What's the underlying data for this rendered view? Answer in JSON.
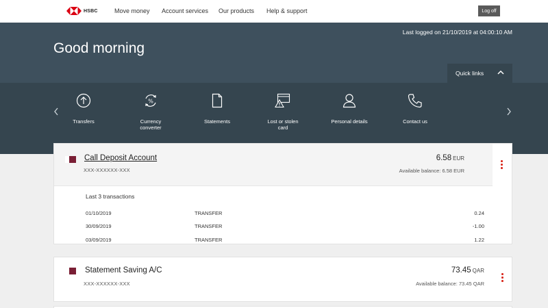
{
  "header": {
    "logo_text": "HSBC",
    "nav": [
      "Move money",
      "Account services",
      "Our products",
      "Help & support"
    ],
    "logoff_label": "Log off"
  },
  "hero": {
    "last_logged": "Last logged on 21/10/2019 at 04:00:10 AM",
    "greeting": "Good morning",
    "quick_links_label": "Quick links"
  },
  "quick_links": [
    {
      "label": "Transfers",
      "icon": "transfer-arrow-icon"
    },
    {
      "label": "Currency converter",
      "icon": "currency-converter-icon"
    },
    {
      "label": "Statements",
      "icon": "document-icon"
    },
    {
      "label": "Lost or stolen card",
      "icon": "card-warning-icon"
    },
    {
      "label": "Personal details",
      "icon": "person-icon"
    },
    {
      "label": "Contact us",
      "icon": "phone-icon"
    }
  ],
  "accounts": [
    {
      "name": "Call Deposit Account",
      "number": "XXX-XXXXXX-XXX",
      "amount": "6.58",
      "currency": "EUR",
      "available": "Available balance: 6.58 EUR",
      "transactions_title": "Last 3 transactions",
      "transactions": [
        {
          "date": "01/10/2019",
          "type": "TRANSFER",
          "amount": "0.24"
        },
        {
          "date": "30/09/2019",
          "type": "TRANSFER",
          "amount": "-1.00"
        },
        {
          "date": "03/09/2019",
          "type": "TRANSFER",
          "amount": "1.22"
        }
      ]
    },
    {
      "name": "Statement Saving A/C",
      "number": "XXX-XXXXXX-XXX",
      "amount": "73.45",
      "currency": "QAR",
      "available": "Available balance: 73.45 QAR"
    }
  ],
  "colors": {
    "hero_bg": "#3e505d",
    "quicklinks_bg": "#35454f",
    "brand_red": "#db0011",
    "account_swatch": "#7a1f35",
    "kebab_red": "#d9281c"
  }
}
